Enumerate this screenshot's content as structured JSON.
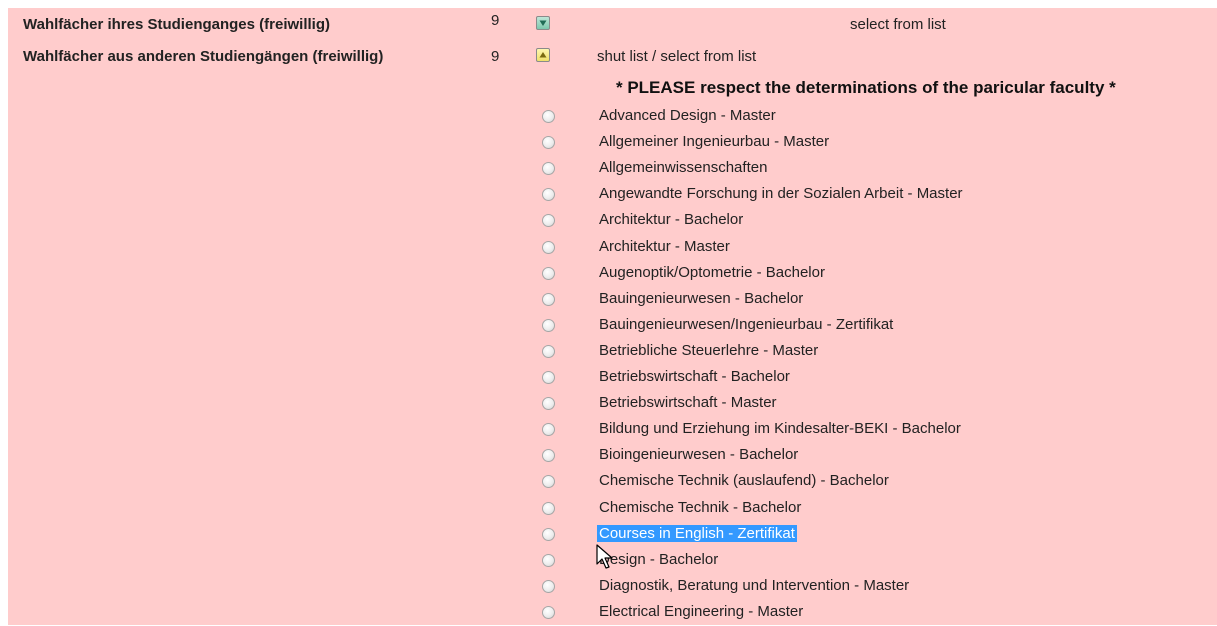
{
  "categories": [
    {
      "label": "Wahlfächer ihres Studienganges (freiwillig)",
      "count": "9",
      "toggle_icon": "expand-down-icon",
      "action": "select from list"
    },
    {
      "label": "Wahlfächer aus anderen Studiengängen (freiwillig)",
      "count": "9",
      "toggle_icon": "collapse-up-icon",
      "action": "shut list / select from list"
    }
  ],
  "notice": "* PLEASE respect the determinations of the paricular faculty *",
  "programs": [
    "Advanced Design - Master",
    "Allgemeiner Ingenieurbau - Master",
    "Allgemeinwissenschaften",
    "Angewandte Forschung in der Sozialen Arbeit - Master",
    "Architektur - Bachelor",
    "Architektur - Master",
    "Augenoptik/Optometrie - Bachelor",
    "Bauingenieurwesen - Bachelor",
    "Bauingenieurwesen/Ingenieurbau - Zertifikat",
    "Betriebliche Steuerlehre - Master",
    "Betriebswirtschaft - Bachelor",
    "Betriebswirtschaft - Master",
    "Bildung und Erziehung im Kindesalter-BEKI - Bachelor",
    "Bioingenieurwesen - Bachelor",
    "Chemische Technik (auslaufend) - Bachelor",
    "Chemische Technik - Bachelor",
    "Courses in English - Zertifikat",
    "Design - Bachelor",
    "Diagnostik, Beratung und Intervention - Master",
    "Electrical Engineering - Master"
  ],
  "highlighted_program": "Courses in English - Zertifikat",
  "colors": {
    "panel_bg": "#ffcccc",
    "selection_bg": "#3399ff"
  }
}
